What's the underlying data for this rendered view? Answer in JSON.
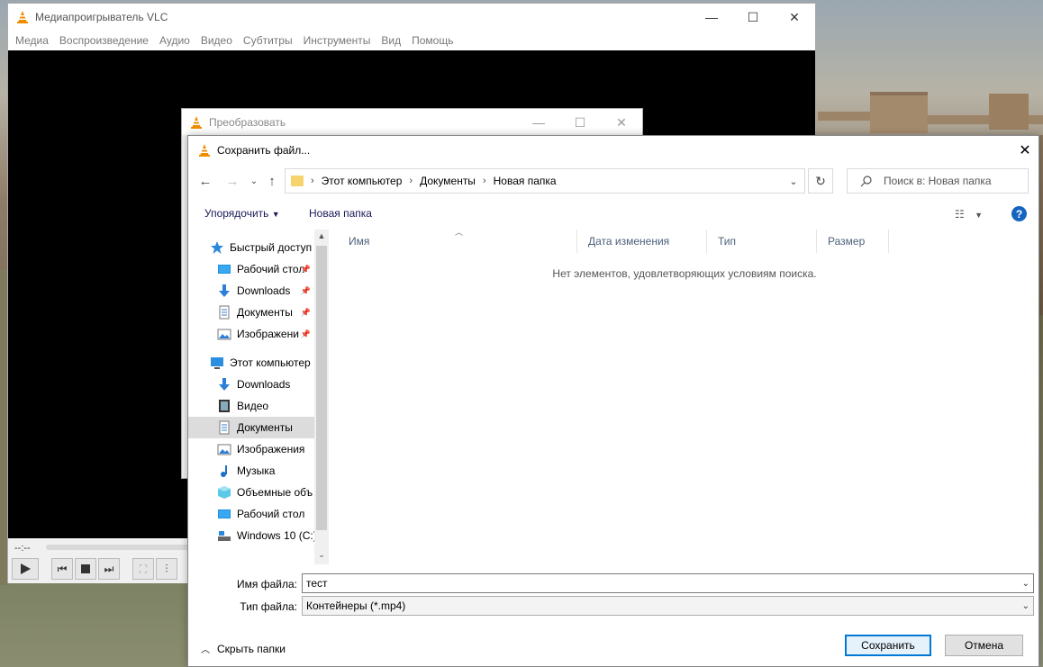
{
  "vlc": {
    "title": "Медиапроигрыватель VLC",
    "menu": [
      "Медиа",
      "Воспроизведение",
      "Аудио",
      "Видео",
      "Субтитры",
      "Инструменты",
      "Вид",
      "Помощь"
    ],
    "time": "--:--"
  },
  "convert": {
    "title": "Преобразовать"
  },
  "save": {
    "title": "Сохранить файл...",
    "breadcrumb": [
      "Этот компьютер",
      "Документы",
      "Новая папка"
    ],
    "search_placeholder": "Поиск в: Новая папка",
    "toolbar": {
      "organize": "Упорядочить",
      "new_folder": "Новая папка"
    },
    "nav": [
      {
        "label": "Быстрый доступ",
        "icon": "star-icon",
        "indent": false,
        "pinned": false,
        "selected": false
      },
      {
        "label": "Рабочий стол",
        "icon": "desktop-icon",
        "indent": true,
        "pinned": true,
        "selected": false
      },
      {
        "label": "Downloads",
        "icon": "download-icon",
        "indent": true,
        "pinned": true,
        "selected": false
      },
      {
        "label": "Документы",
        "icon": "document-icon",
        "indent": true,
        "pinned": true,
        "selected": false
      },
      {
        "label": "Изображени",
        "icon": "image-icon",
        "indent": true,
        "pinned": true,
        "selected": false
      },
      {
        "label": "Этот компьютер",
        "icon": "computer-icon",
        "indent": false,
        "pinned": false,
        "selected": false
      },
      {
        "label": "Downloads",
        "icon": "download-icon",
        "indent": true,
        "pinned": false,
        "selected": false
      },
      {
        "label": "Видео",
        "icon": "video-icon",
        "indent": true,
        "pinned": false,
        "selected": false
      },
      {
        "label": "Документы",
        "icon": "document-icon",
        "indent": true,
        "pinned": false,
        "selected": true
      },
      {
        "label": "Изображения",
        "icon": "image-icon",
        "indent": true,
        "pinned": false,
        "selected": false
      },
      {
        "label": "Музыка",
        "icon": "music-icon",
        "indent": true,
        "pinned": false,
        "selected": false
      },
      {
        "label": "Объемные объ",
        "icon": "3d-objects-icon",
        "indent": true,
        "pinned": false,
        "selected": false
      },
      {
        "label": "Рабочий стол",
        "icon": "desktop-icon",
        "indent": true,
        "pinned": false,
        "selected": false
      },
      {
        "label": "Windows 10 (C:)",
        "icon": "drive-icon",
        "indent": true,
        "pinned": false,
        "selected": false
      }
    ],
    "columns": [
      "Имя",
      "Дата изменения",
      "Тип",
      "Размер"
    ],
    "empty_message": "Нет элементов, удовлетворяющих условиям поиска.",
    "filename_label": "Имя файла:",
    "filename_value": "тест",
    "filetype_label": "Тип файла:",
    "filetype_value": "Контейнеры (*.mp4)",
    "hide_folders": "Скрыть папки",
    "save_button": "Сохранить",
    "cancel_button": "Отмена"
  },
  "colors": {
    "accent": "#0078d7",
    "selected": "#dcdcdc",
    "help": "#1565c0",
    "vlc_orange": "#f08c00"
  }
}
